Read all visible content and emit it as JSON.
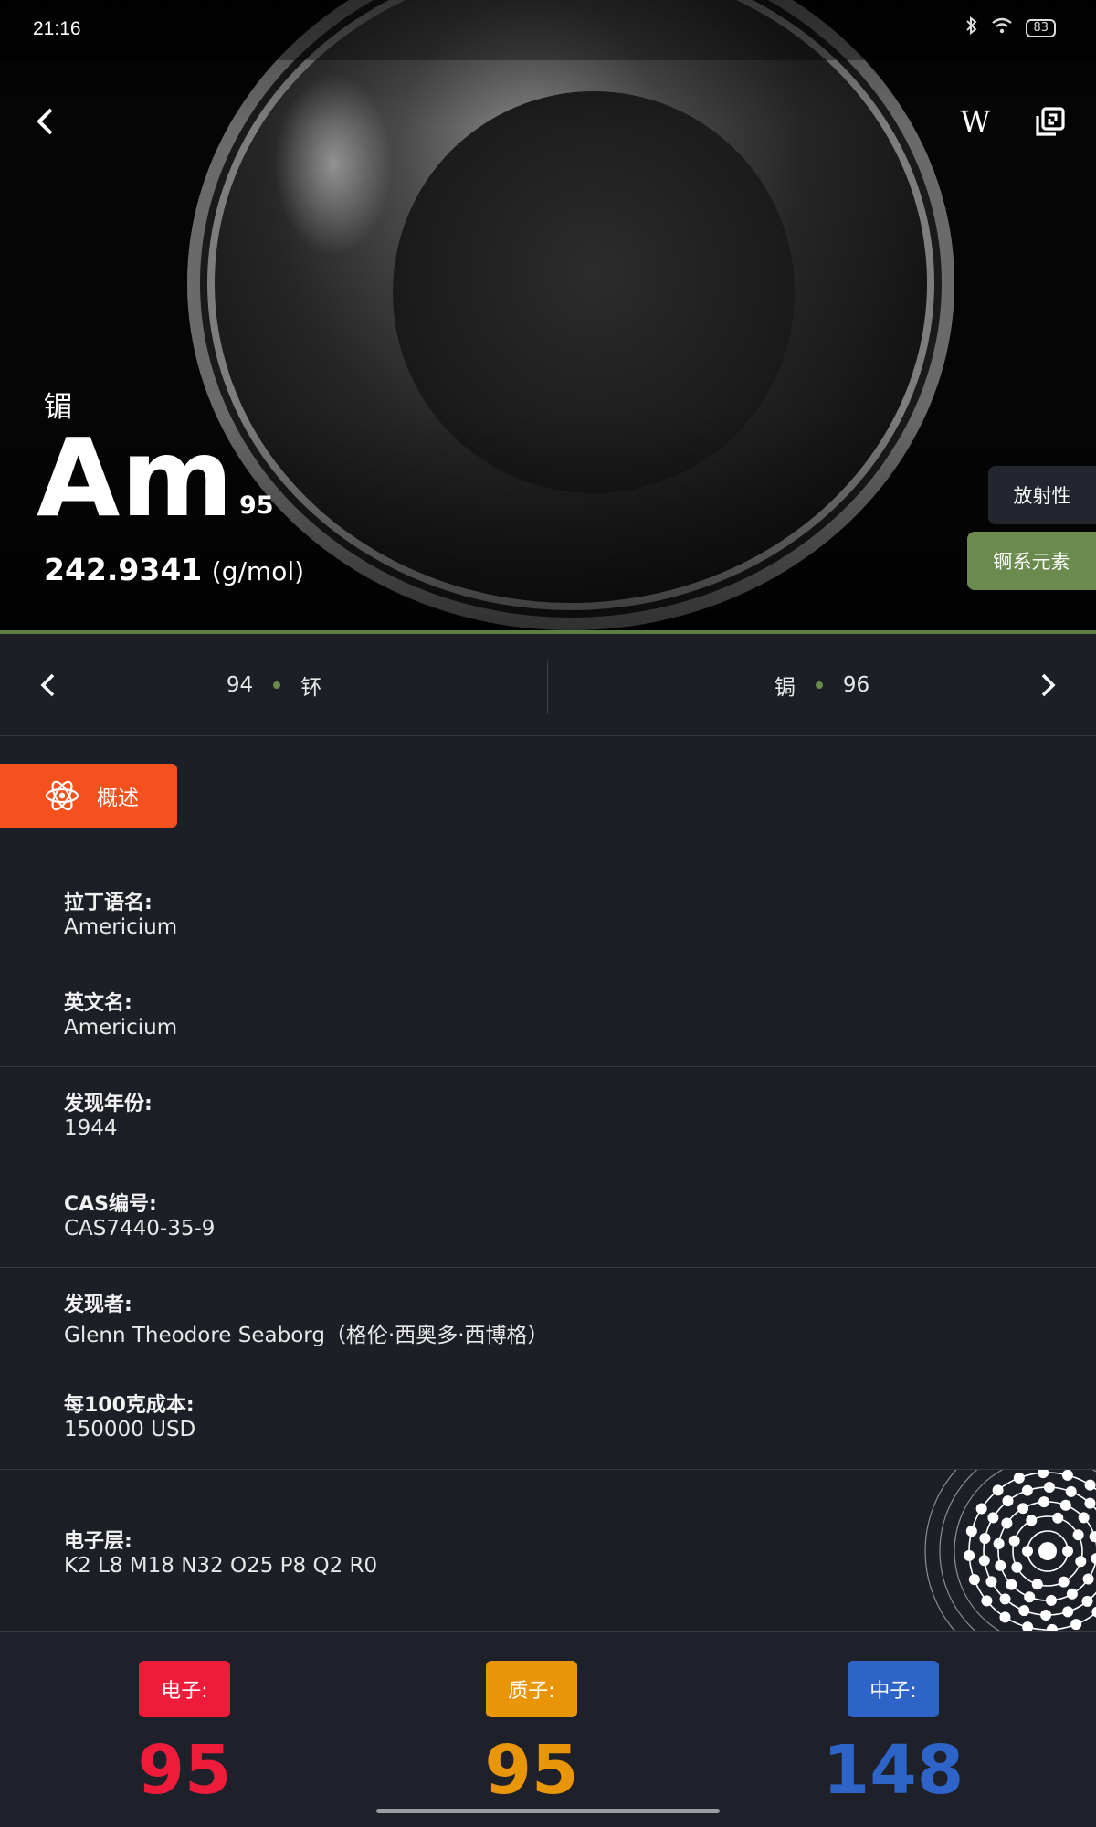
{
  "status_bar": {
    "time": "21:16",
    "battery": "83"
  },
  "element": {
    "name_cn": "镅",
    "symbol": "Am",
    "atomic_number": "95",
    "mass": "242.9341",
    "mass_unit": "(g/mol)"
  },
  "toolbar": {
    "wiki_label": "W"
  },
  "tags": {
    "radioactive": "放射性",
    "series": "锕系元素"
  },
  "nav": {
    "prev_number": "94",
    "prev_name": "钚",
    "next_name": "锔",
    "next_number": "96"
  },
  "overview_tab": {
    "label": "概述"
  },
  "info": [
    {
      "label": "拉丁语名:",
      "value": "Americium"
    },
    {
      "label": "英文名:",
      "value": "Americium"
    },
    {
      "label": "发现年份:",
      "value": "1944"
    },
    {
      "label": "CAS编号:",
      "value": "CAS7440-35-9"
    },
    {
      "label": "发现者:",
      "value": "Glenn Theodore Seaborg（格伦·西奥多·西博格）"
    },
    {
      "label": "每100克成本:",
      "value": "150000 USD"
    }
  ],
  "electron_shells": {
    "label": "电子层:",
    "value": "K2 L8 M18 N32 O25 P8 Q2 R0"
  },
  "particles": {
    "electrons": {
      "label": "电子:",
      "value": "95",
      "color": "#ee1c3a"
    },
    "protons": {
      "label": "质子:",
      "value": "95",
      "color": "#e8950a"
    },
    "neutrons": {
      "label": "中子:",
      "value": "148",
      "color": "#2e63c8"
    }
  },
  "colors": {
    "accent_orange": "#f4511e",
    "series_green": "#6a8a4e",
    "background": "#1c1f26"
  }
}
